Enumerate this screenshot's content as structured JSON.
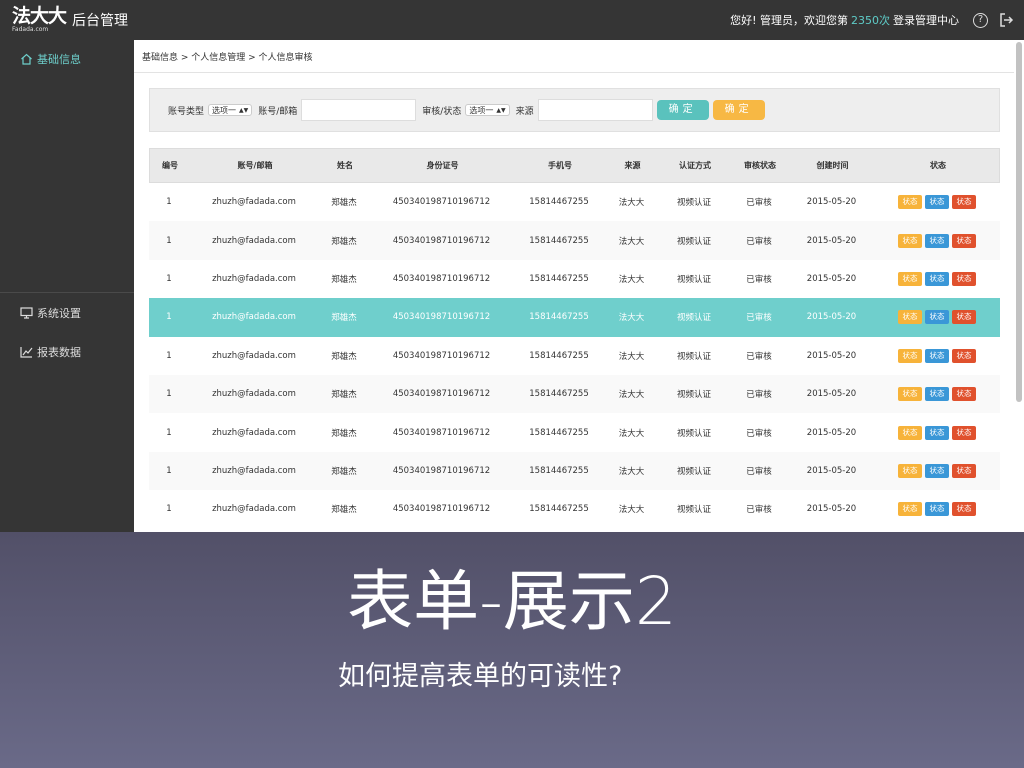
{
  "header": {
    "logo_cn": "法大大",
    "logo_en": "Fadada.com",
    "app_title": "后台管理",
    "greeting": "您好! 管理员，欢迎您第",
    "login_count": "2350次",
    "center_link": "登录管理中心",
    "help_icon": "?"
  },
  "sidebar": {
    "items": [
      {
        "label": "基础信息",
        "icon": "home-icon"
      },
      {
        "label": "系统设置",
        "icon": "monitor-icon"
      },
      {
        "label": "报表数据",
        "icon": "chart-icon"
      }
    ]
  },
  "breadcrumb": "基础信息 > 个人信息管理 > 个人信息审核",
  "filter": {
    "account_type_label": "账号类型",
    "account_type_value": "选项一",
    "account_email_label": "账号/邮箱",
    "audit_status_label": "审核/状态",
    "audit_status_value": "选项一",
    "source_label": "来源",
    "confirm1": "确定",
    "confirm2": "确定"
  },
  "table": {
    "headers": [
      "编号",
      "账号/邮箱",
      "姓名",
      "身份证号",
      "手机号",
      "来源",
      "认证方式",
      "审核状态",
      "创建时间",
      "状态"
    ],
    "rows": [
      [
        "1",
        "zhuzh@fadada.com",
        "郑雄杰",
        "450340198710196712",
        "15814467255",
        "法大大",
        "视频认证",
        "已审核",
        "2015-05-20"
      ],
      [
        "1",
        "zhuzh@fadada.com",
        "郑雄杰",
        "450340198710196712",
        "15814467255",
        "法大大",
        "视频认证",
        "已审核",
        "2015-05-20"
      ],
      [
        "1",
        "zhuzh@fadada.com",
        "郑雄杰",
        "450340198710196712",
        "15814467255",
        "法大大",
        "视频认证",
        "已审核",
        "2015-05-20"
      ],
      [
        "1",
        "zhuzh@fadada.com",
        "郑雄杰",
        "450340198710196712",
        "15814467255",
        "法大大",
        "视频认证",
        "已审核",
        "2015-05-20"
      ],
      [
        "1",
        "zhuzh@fadada.com",
        "郑雄杰",
        "450340198710196712",
        "15814467255",
        "法大大",
        "视频认证",
        "已审核",
        "2015-05-20"
      ],
      [
        "1",
        "zhuzh@fadada.com",
        "郑雄杰",
        "450340198710196712",
        "15814467255",
        "法大大",
        "视频认证",
        "已审核",
        "2015-05-20"
      ],
      [
        "1",
        "zhuzh@fadada.com",
        "郑雄杰",
        "450340198710196712",
        "15814467255",
        "法大大",
        "视频认证",
        "已审核",
        "2015-05-20"
      ],
      [
        "1",
        "zhuzh@fadada.com",
        "郑雄杰",
        "450340198710196712",
        "15814467255",
        "法大大",
        "视频认证",
        "已审核",
        "2015-05-20"
      ],
      [
        "1",
        "zhuzh@fadada.com",
        "郑雄杰",
        "450340198710196712",
        "15814467255",
        "法大大",
        "视频认证",
        "已审核",
        "2015-05-20"
      ]
    ],
    "status_tag": "状态",
    "highlighted_row": 3,
    "tag_colors": {
      "yellow": "#f7b33a",
      "blue": "#3a97d7",
      "red": "#e0512d"
    }
  },
  "overlay": {
    "title": "表单-展示2",
    "subtitle": "如何提高表单的可读性?"
  },
  "colors": {
    "accent": "#6fcfcc",
    "topbar": "#353535"
  }
}
